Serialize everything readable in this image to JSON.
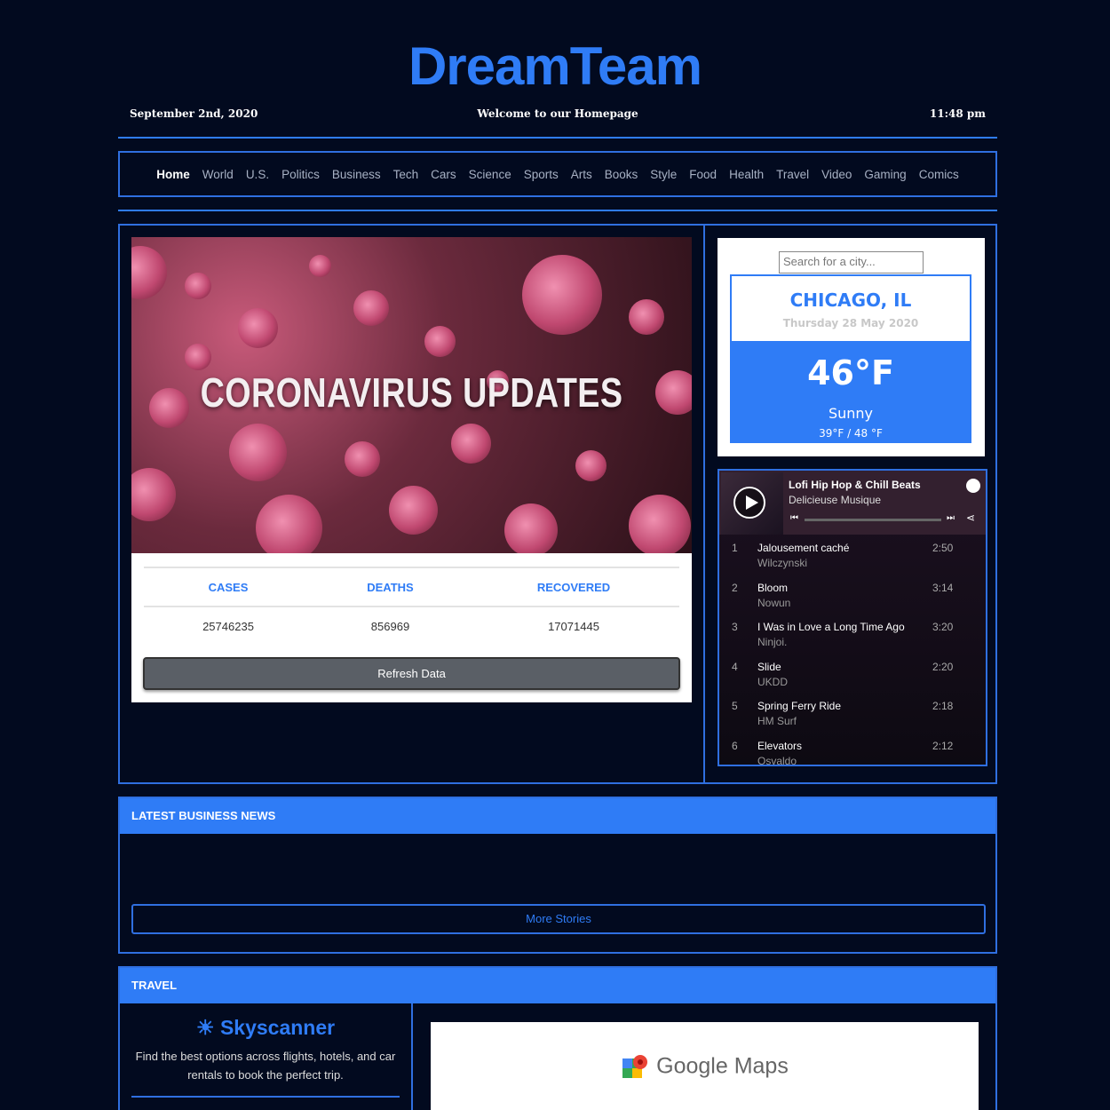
{
  "site": {
    "logo": "DreamTeam"
  },
  "topbar": {
    "date": "September 2nd, 2020",
    "welcome": "Welcome to our Homepage",
    "time": "11:48 pm"
  },
  "nav": {
    "items": [
      "Home",
      "World",
      "U.S.",
      "Politics",
      "Business",
      "Tech",
      "Cars",
      "Science",
      "Sports",
      "Arts",
      "Books",
      "Style",
      "Food",
      "Health",
      "Travel",
      "Video",
      "Gaming",
      "Comics"
    ],
    "active": "Home"
  },
  "covid": {
    "image_title": "CORONAVIRUS UPDATES",
    "headers": [
      "CASES",
      "DEATHS",
      "RECOVERED"
    ],
    "values": [
      "25746235",
      "856969",
      "17071445"
    ],
    "refresh_label": "Refresh Data"
  },
  "weather": {
    "search_placeholder": "Search for a city...",
    "city": "CHICAGO, IL",
    "day": "Thursday 28 May 2020",
    "temp": "46°F",
    "condition": "Sunny",
    "range": "39°F / 48 °F"
  },
  "player": {
    "title": "Lofi Hip Hop & Chill Beats",
    "artist": "Delicieuse Musique",
    "tracks": [
      {
        "num": "1",
        "name": "Jalousement caché",
        "artist": "Wilczynski",
        "dur": "2:50"
      },
      {
        "num": "2",
        "name": "Bloom",
        "artist": "Nowun",
        "dur": "3:14"
      },
      {
        "num": "3",
        "name": "I Was in Love a Long Time Ago",
        "artist": "Ninjoi.",
        "dur": "3:20"
      },
      {
        "num": "4",
        "name": "Slide",
        "artist": "UKDD",
        "dur": "2:20"
      },
      {
        "num": "5",
        "name": "Spring Ferry Ride",
        "artist": "HM Surf",
        "dur": "2:18"
      },
      {
        "num": "6",
        "name": "Elevators",
        "artist": "Osvaldo",
        "dur": "2:12"
      }
    ]
  },
  "business": {
    "heading": "LATEST BUSINESS NEWS",
    "more_label": "More Stories"
  },
  "travel": {
    "heading": "TRAVEL",
    "skyscanner": "Skyscanner",
    "skyscanner_desc": "Find the best options across flights, hotels, and car rentals to book the perfect trip.",
    "maps": "Google Maps"
  },
  "colors": {
    "accent": "#2f7cf6",
    "background": "#020a1f"
  }
}
